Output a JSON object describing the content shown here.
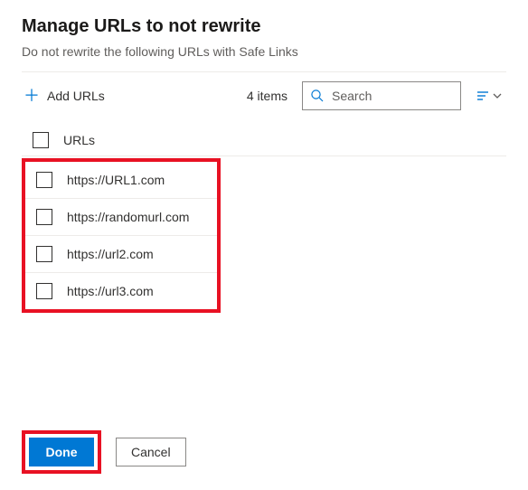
{
  "header": {
    "title": "Manage URLs to not rewrite",
    "subtitle": "Do not rewrite the following URLs with Safe Links"
  },
  "toolbar": {
    "add_label": "Add URLs",
    "item_count_text": "4 items",
    "search_placeholder": "Search"
  },
  "table": {
    "column_header": "URLs",
    "rows": [
      {
        "url": "https://URL1.com"
      },
      {
        "url": "https://randomurl.com"
      },
      {
        "url": "https://url2.com"
      },
      {
        "url": "https://url3.com"
      }
    ]
  },
  "footer": {
    "done_label": "Done",
    "cancel_label": "Cancel"
  }
}
